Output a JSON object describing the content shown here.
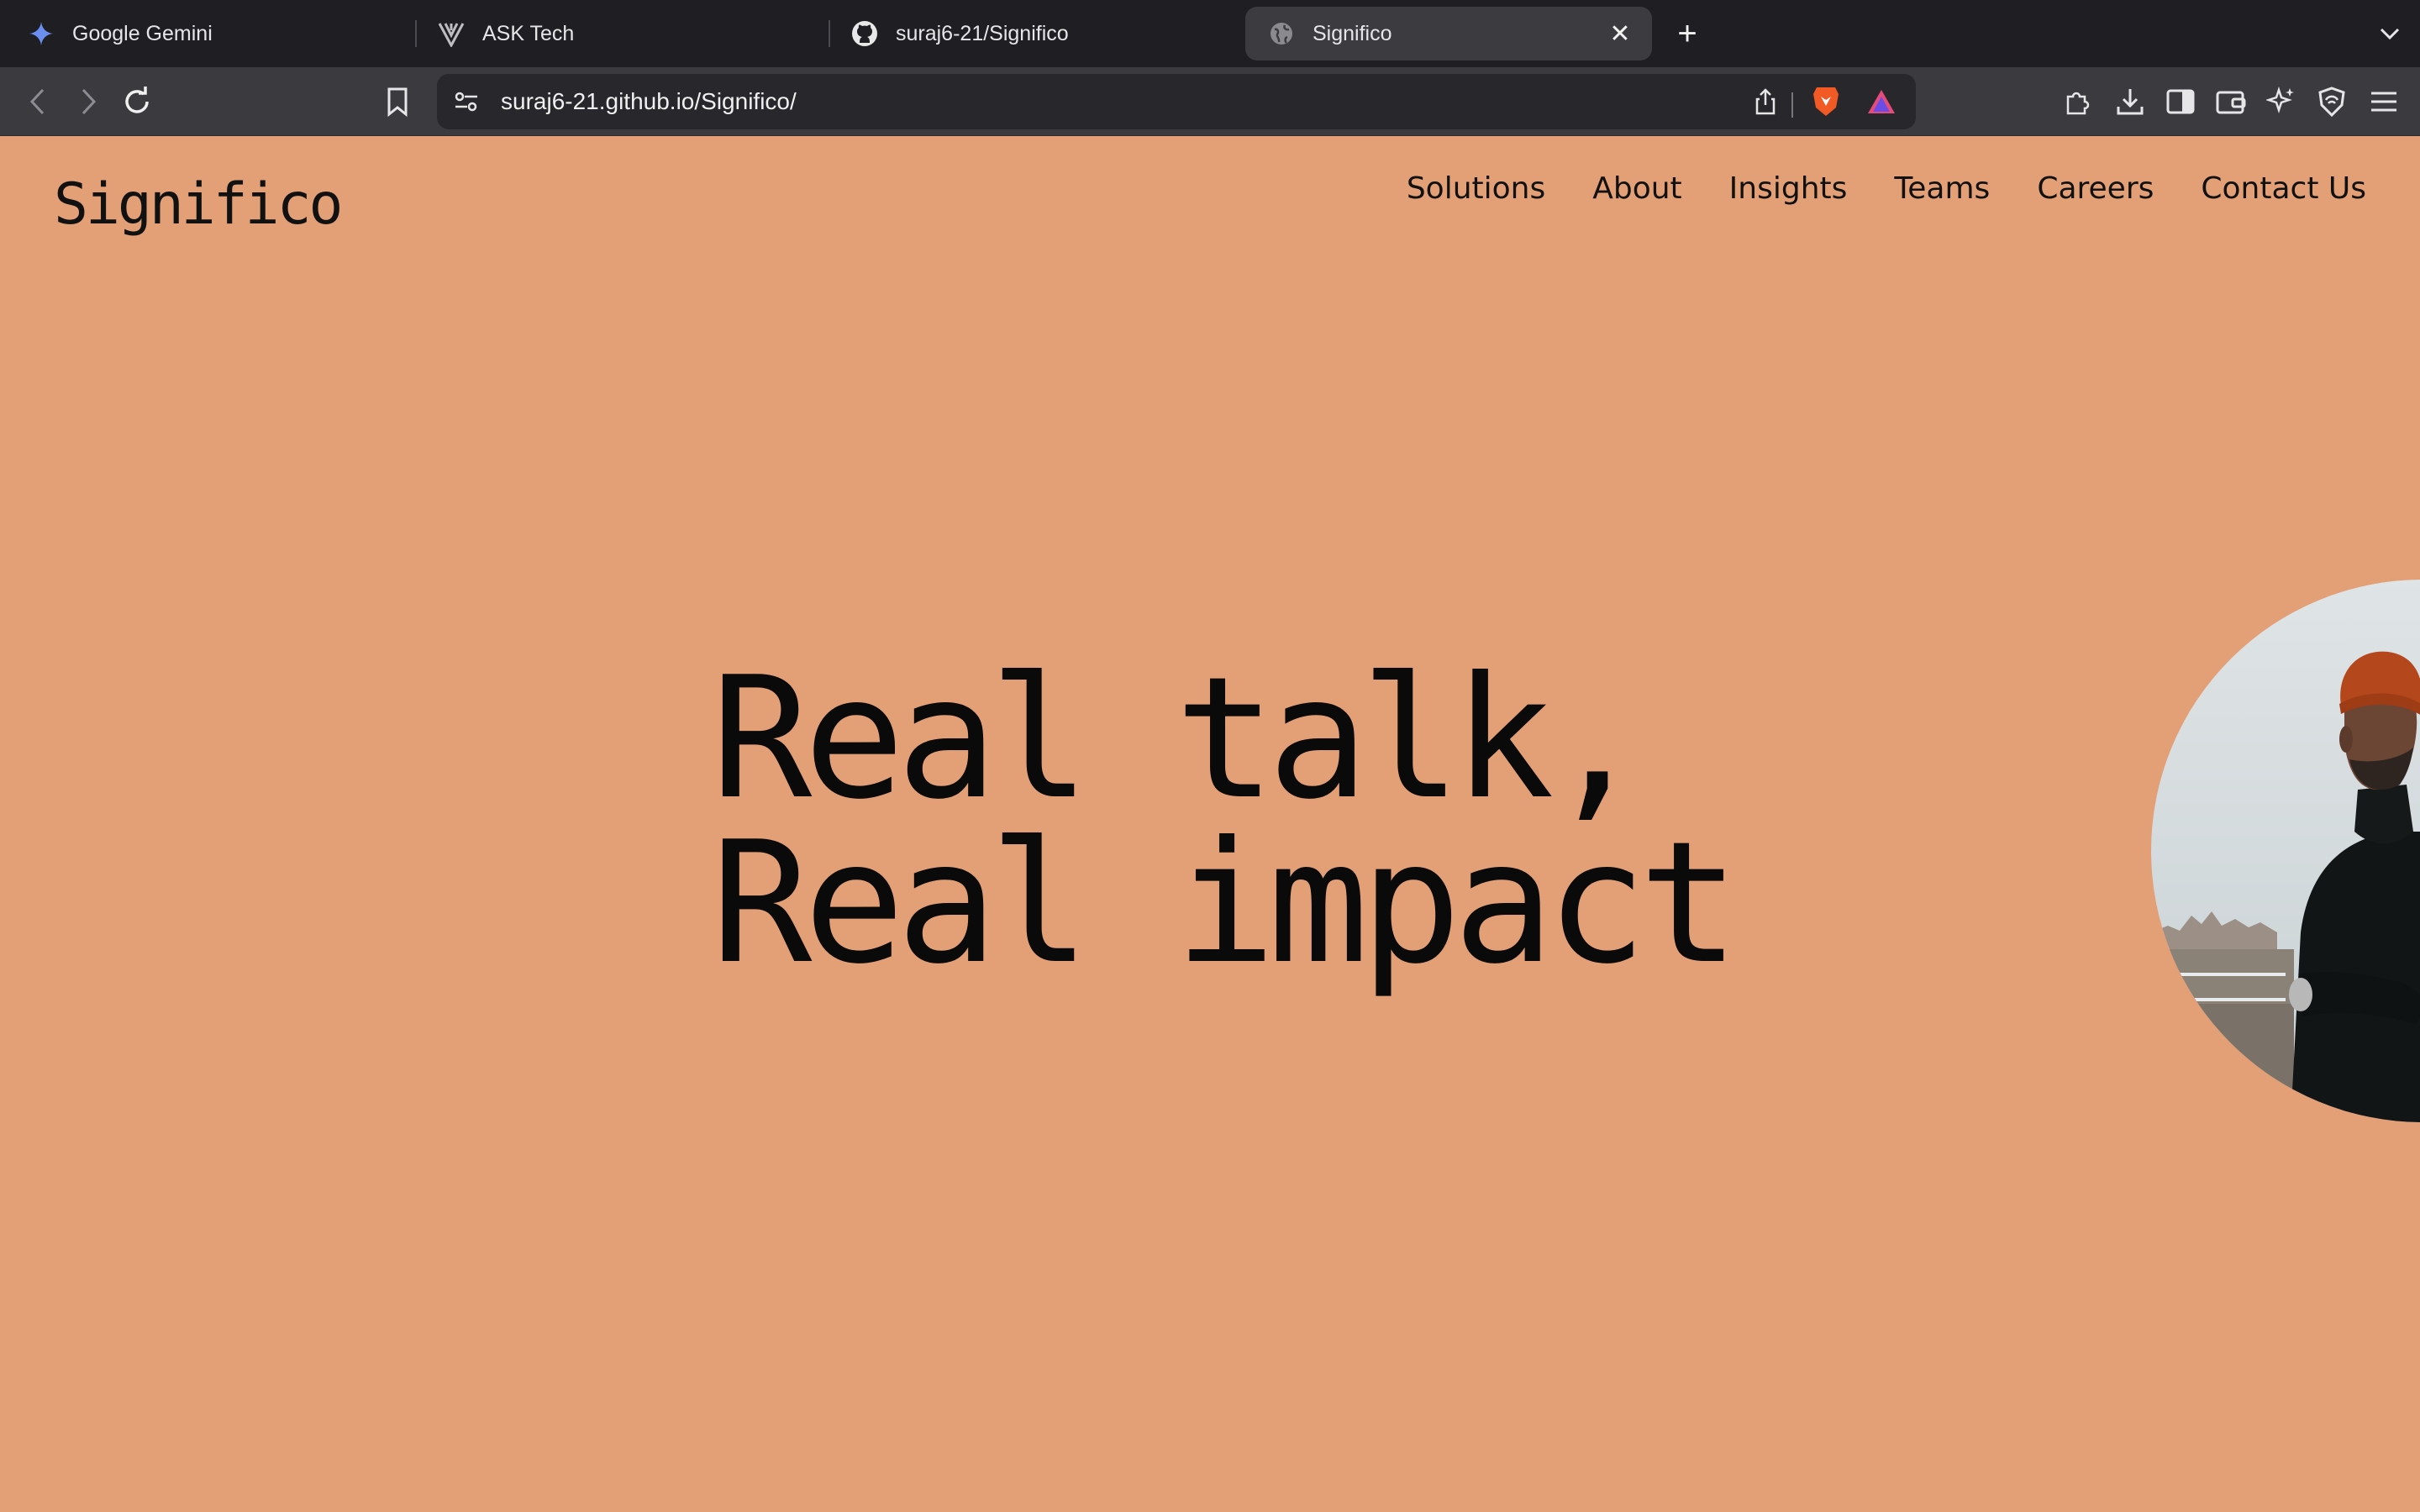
{
  "browser": {
    "tabs": [
      {
        "title": "Google Gemini",
        "icon": "gemini-star-icon",
        "active": false
      },
      {
        "title": "ASK Tech",
        "icon": "ask-tech-icon",
        "active": false
      },
      {
        "title": "suraj6-21/Significo",
        "icon": "github-icon",
        "active": false
      },
      {
        "title": "Significo",
        "icon": "globe-icon",
        "active": true
      }
    ],
    "url": "suraj6-21.github.io/Significo/"
  },
  "site": {
    "logo": "Significo",
    "nav": [
      "Solutions",
      "About",
      "Insights",
      "Teams",
      "Careers",
      "Contact Us"
    ],
    "hero": {
      "line1": "Real talk,",
      "line2": "Real impact"
    },
    "background_color": "#e3a077"
  }
}
